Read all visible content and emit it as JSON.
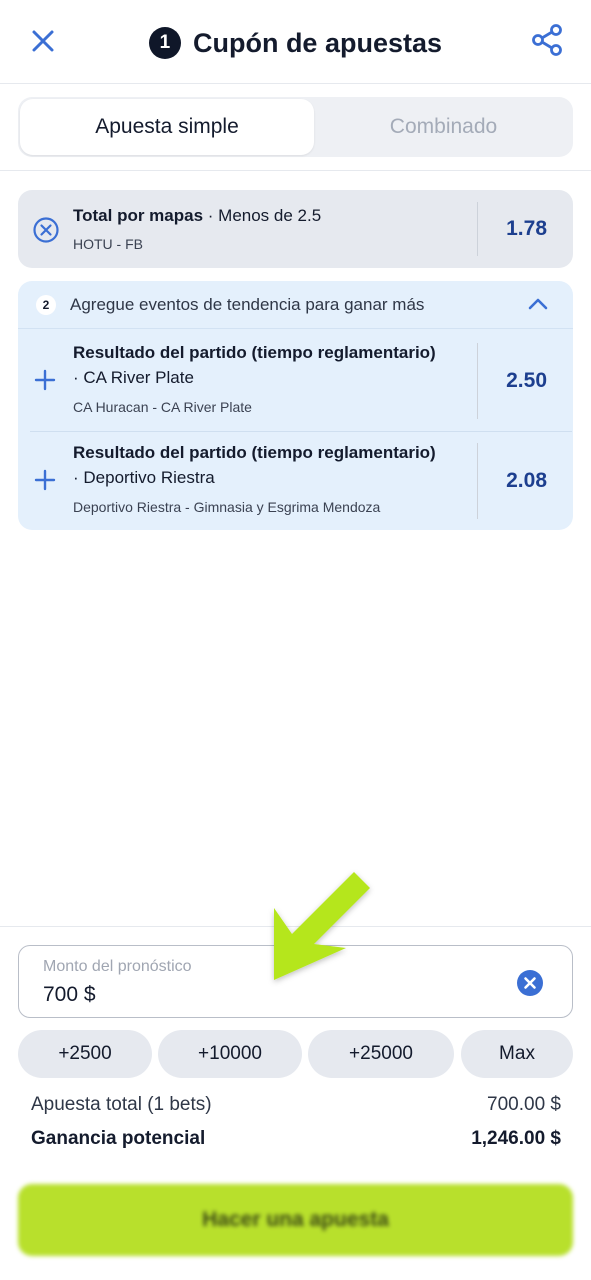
{
  "header": {
    "bet_count": "1",
    "title": "Cupón de apuestas"
  },
  "tabs": [
    {
      "label": "Apuesta simple",
      "active": true
    },
    {
      "label": "Combinado",
      "active": false
    }
  ],
  "selected_bet": {
    "market": "Total por mapas",
    "selection": " · Menos de 2.5",
    "event": "HOTU - FB",
    "odds": "1.78"
  },
  "trending": {
    "count": "2",
    "text": "Agregue eventos de tendencia para ganar más",
    "items": [
      {
        "market": "Resultado del partido (tiempo reglamentario)",
        "selection": "· CA River Plate",
        "event": "CA Huracan - CA River Plate",
        "odds": "2.50"
      },
      {
        "market": "Resultado del partido (tiempo reglamentario)",
        "selection": "· Deportivo Riestra",
        "event": "Deportivo Riestra - Gimnasia y Esgrima Mendoza",
        "odds": "2.08"
      }
    ]
  },
  "stake": {
    "label": "Monto del pronóstico",
    "value": "700 $"
  },
  "quick_amounts": [
    "+2500",
    "+10000",
    "+25000",
    "Max"
  ],
  "summary": {
    "total_label": "Apuesta total (1 bets)",
    "total_value": "700.00 $",
    "gain_label": "Ganancia potencial",
    "gain_value": "1,246.00 $"
  },
  "place_bet_label": "Hacer una apuesta",
  "colors": {
    "accent_blue": "#1d3f8f",
    "icon_blue": "#3b6fd4",
    "cta_green": "#b8e02c",
    "arrow_green": "#b5e61d"
  }
}
